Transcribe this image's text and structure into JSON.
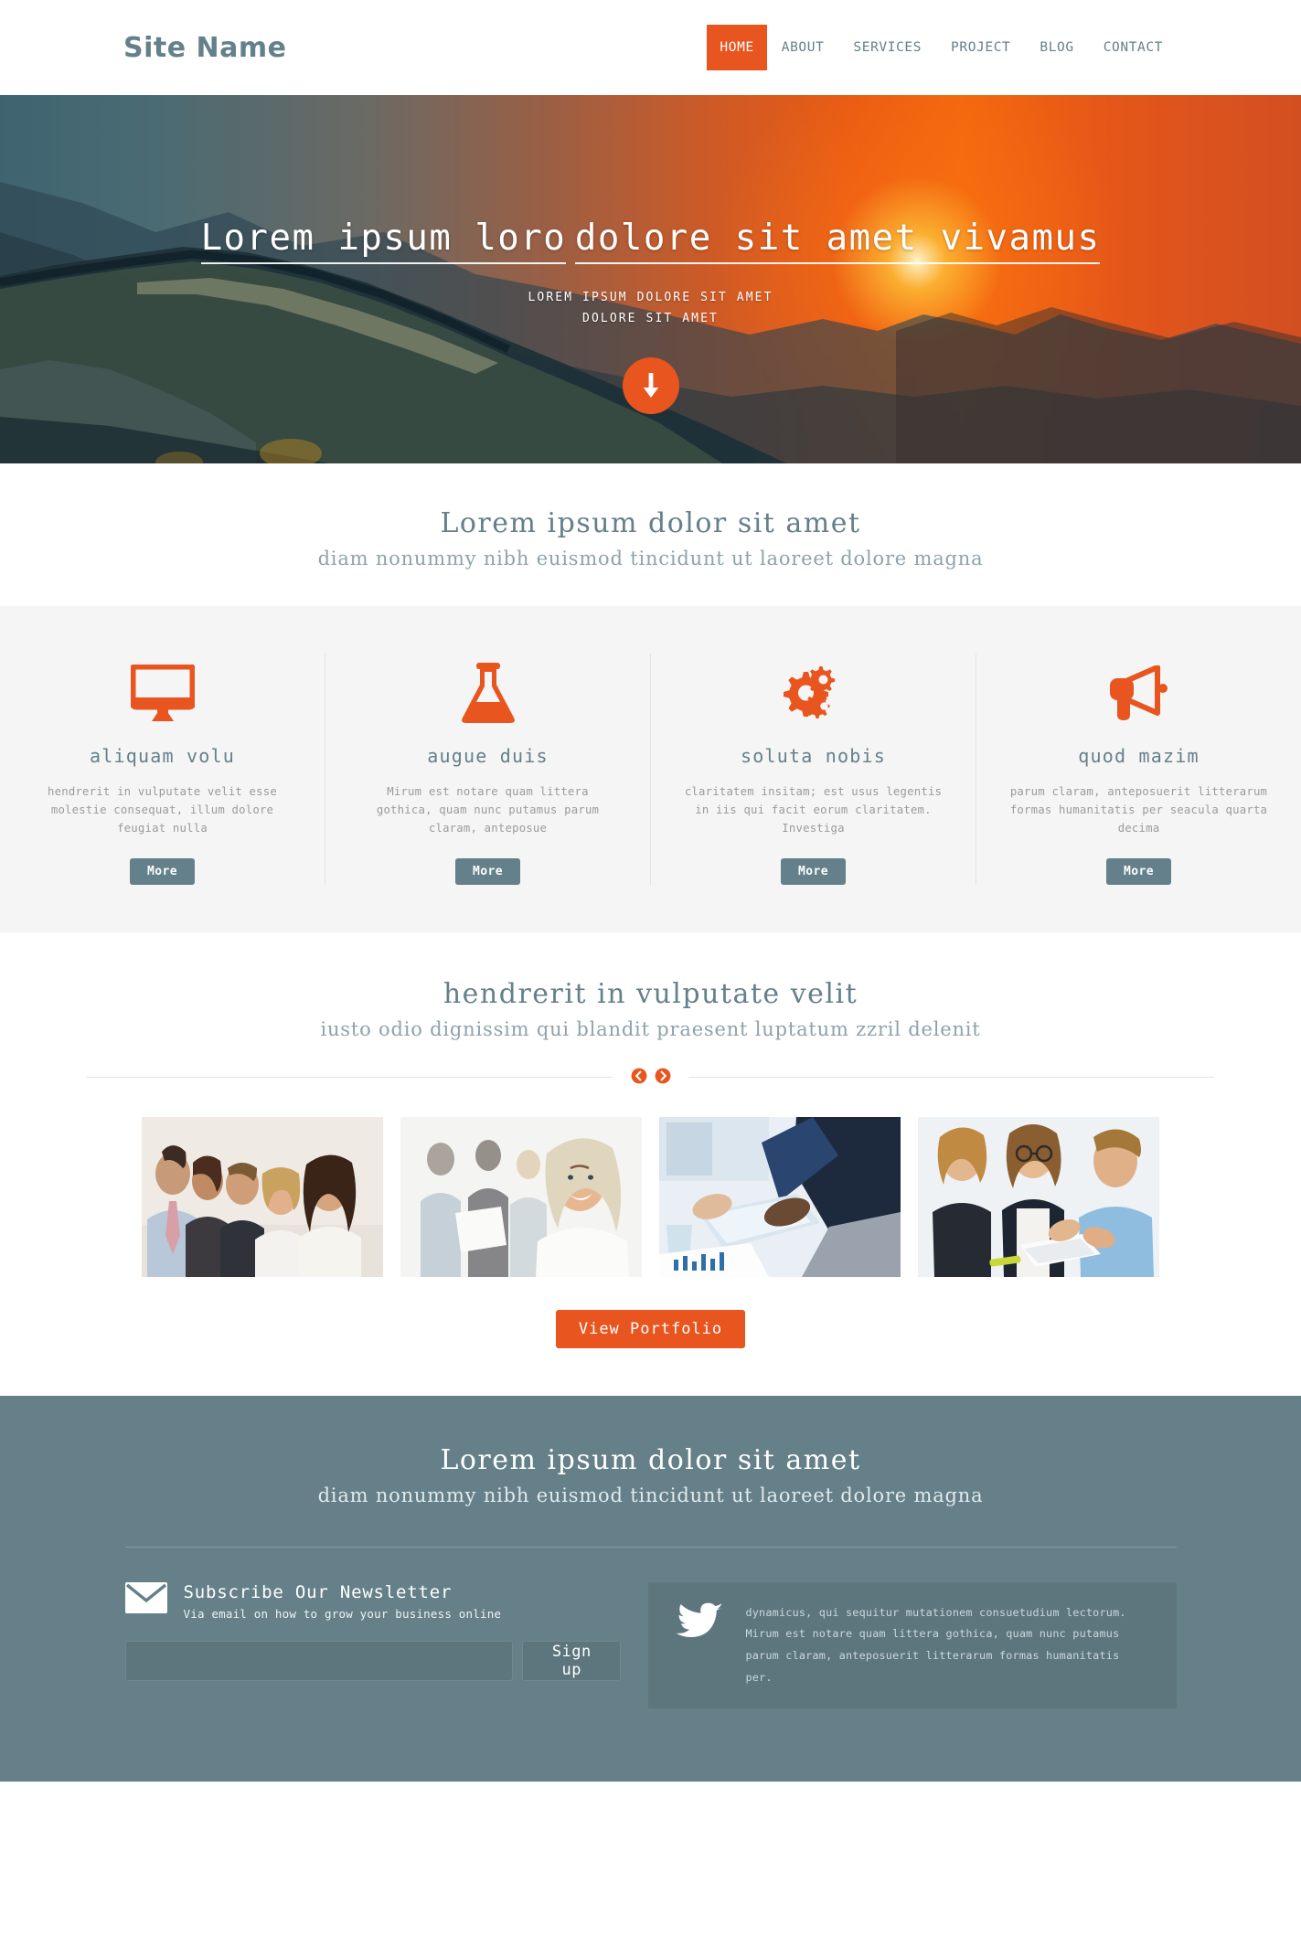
{
  "header": {
    "logo": "Site Name",
    "nav": [
      {
        "label": "HOME",
        "active": true
      },
      {
        "label": "ABOUT",
        "active": false
      },
      {
        "label": "SERVICES",
        "active": false
      },
      {
        "label": "PROJECT",
        "active": false
      },
      {
        "label": "BLOG",
        "active": false
      },
      {
        "label": "CONTACT",
        "active": false
      }
    ]
  },
  "hero": {
    "title_line1": "Lorem ipsum loro",
    "title_line2": "dolore sit amet vivamus",
    "sub_line1": "LOREM IPSUM DOLORE SIT AMET",
    "sub_line2": "DOLORE SIT AMET",
    "scroll_icon": "arrow-down-icon"
  },
  "intro": {
    "title": "Lorem ipsum dolor sit amet",
    "subtitle": "diam nonummy nibh euismod tincidunt ut laoreet dolore magna"
  },
  "features": [
    {
      "icon": "monitor-icon",
      "title": "aliquam volu",
      "text": "hendrerit in vulputate velit esse molestie consequat, illum dolore feugiat nulla",
      "button": "More"
    },
    {
      "icon": "flask-icon",
      "title": "augue duis",
      "text": "Mirum est notare quam littera gothica, quam nunc putamus parum claram, anteposue",
      "button": "More"
    },
    {
      "icon": "gears-icon",
      "title": "soluta nobis",
      "text": "claritatem insitam; est usus legentis in iis qui facit eorum claritatem. Investiga",
      "button": "More"
    },
    {
      "icon": "megaphone-icon",
      "title": "quod mazim",
      "text": "parum claram, anteposuerit litterarum formas humanitatis per seacula quarta decima",
      "button": "More"
    }
  ],
  "portfolio": {
    "title": "hendrerit in vulputate velit",
    "subtitle": "iusto odio dignissim qui blandit praesent luptatum zzril delenit",
    "prev_icon": "arrow-left-circle-icon",
    "next_icon": "arrow-right-circle-icon",
    "thumbs": [
      {
        "alt": "business-team-group-photo"
      },
      {
        "alt": "smiling-businesswoman-photo"
      },
      {
        "alt": "meeting-tablet-documents-photo"
      },
      {
        "alt": "colleagues-reviewing-book-photo"
      }
    ],
    "view_button": "View Portfolio"
  },
  "footer": {
    "title": "Lorem ipsum dolor sit amet",
    "subtitle": "diam nonummy nibh euismod tincidunt ut laoreet dolore magna",
    "newsletter": {
      "icon": "envelope-icon",
      "title": "Subscribe Our Newsletter",
      "subtitle": "Via email on how to grow your business online",
      "input_value": "",
      "input_placeholder": "",
      "button": "Sign up"
    },
    "tweet": {
      "icon": "twitter-bird-icon",
      "text": "dynamicus, qui sequitur mutationem consuetudium lectorum. Mirum est notare quam littera gothica, quam nunc putamus parum claram, anteposuerit litterarum formas humanitatis per."
    }
  },
  "colors": {
    "accent": "#e8551f",
    "slate": "#64808a",
    "footer_bg": "#658088",
    "feature_bg": "#f5f5f5",
    "muted_text": "#9b9b9b"
  }
}
